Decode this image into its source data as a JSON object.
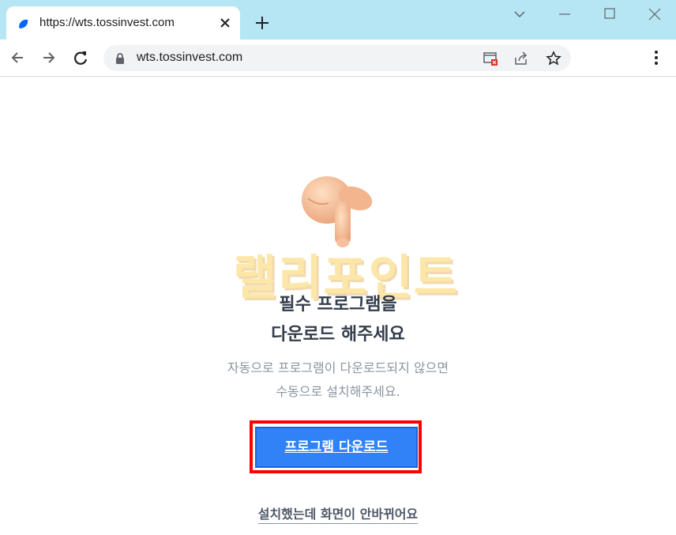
{
  "browser": {
    "tab_title": "https://wts.tossinvest.com",
    "url": "wts.tossinvest.com",
    "icons": [
      "favicon-icon",
      "close-tab-icon",
      "new-tab-icon",
      "chevron-down-icon",
      "minimize-icon",
      "maximize-icon",
      "close-window-icon",
      "back-icon",
      "forward-icon",
      "reload-icon",
      "lock-icon",
      "popup-blocked-icon",
      "share-icon",
      "star-icon",
      "menu-icon"
    ]
  },
  "page": {
    "watermark": "랠리포인트",
    "title_line1": "필수 프로그램을",
    "title_line2": "다운로드 해주세요",
    "subtitle_line1": "자동으로 프로그램이 다운로드되지 않으면",
    "subtitle_line2": "수동으로 설치해주세요.",
    "download_button": "프로그램 다운로드",
    "installed_link": "설치했는데 화면이 안바뀌어요",
    "accent_color": "#3182f6",
    "highlight_color": "#ff0000"
  }
}
